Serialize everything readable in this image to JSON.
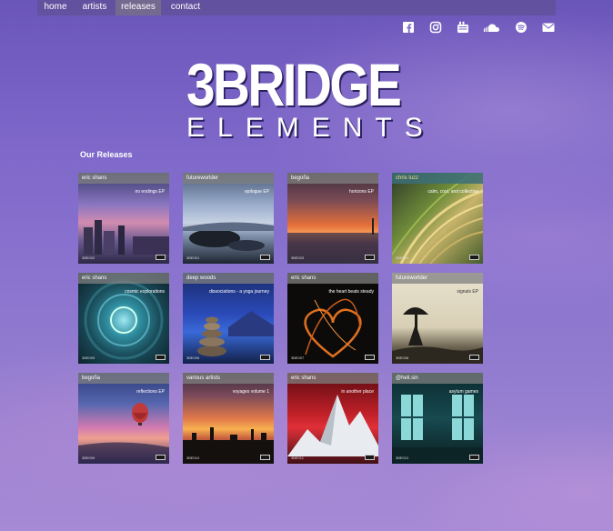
{
  "nav": {
    "items": [
      "home",
      "artists",
      "releases",
      "contact"
    ],
    "active": "releases"
  },
  "social": [
    "facebook-icon",
    "instagram-icon",
    "youtube-icon",
    "soundcloud-icon",
    "spotify-icon",
    "email-icon"
  ],
  "logo": {
    "line1": "3BRIDGE",
    "line2": "ELEMENTS"
  },
  "section_title": "Our Releases",
  "releases": [
    {
      "artist": "eric shans",
      "title": "no endings EP",
      "cat": "3BE002"
    },
    {
      "artist": "futureworlder",
      "title": "epilogue EP",
      "cat": "3BE001"
    },
    {
      "artist": "begoña",
      "title": "horizons EP",
      "cat": "3BE003"
    },
    {
      "artist": "chris luzz",
      "title": "calm, cool, and collective",
      "cat": "3BE004"
    },
    {
      "artist": "eric shans",
      "title": "cosmic explorations",
      "cat": "3BE005"
    },
    {
      "artist": "deep woods",
      "title": "dissociations - a yoga journey",
      "cat": "3BE006"
    },
    {
      "artist": "eric shans",
      "title": "the heart beats steady",
      "cat": "3BE007"
    },
    {
      "artist": "futureworlder",
      "title": "signals EP",
      "cat": "3BE008"
    },
    {
      "artist": "begoña",
      "title": "reflections EP",
      "cat": "3BE009"
    },
    {
      "artist": "various artists",
      "title": "voyages volume 1",
      "cat": "3BE010"
    },
    {
      "artist": "eric shans",
      "title": "in another place",
      "cat": "3BE011"
    },
    {
      "artist": "@heli.sin",
      "title": "asylum games",
      "cat": "3BE012"
    }
  ]
}
